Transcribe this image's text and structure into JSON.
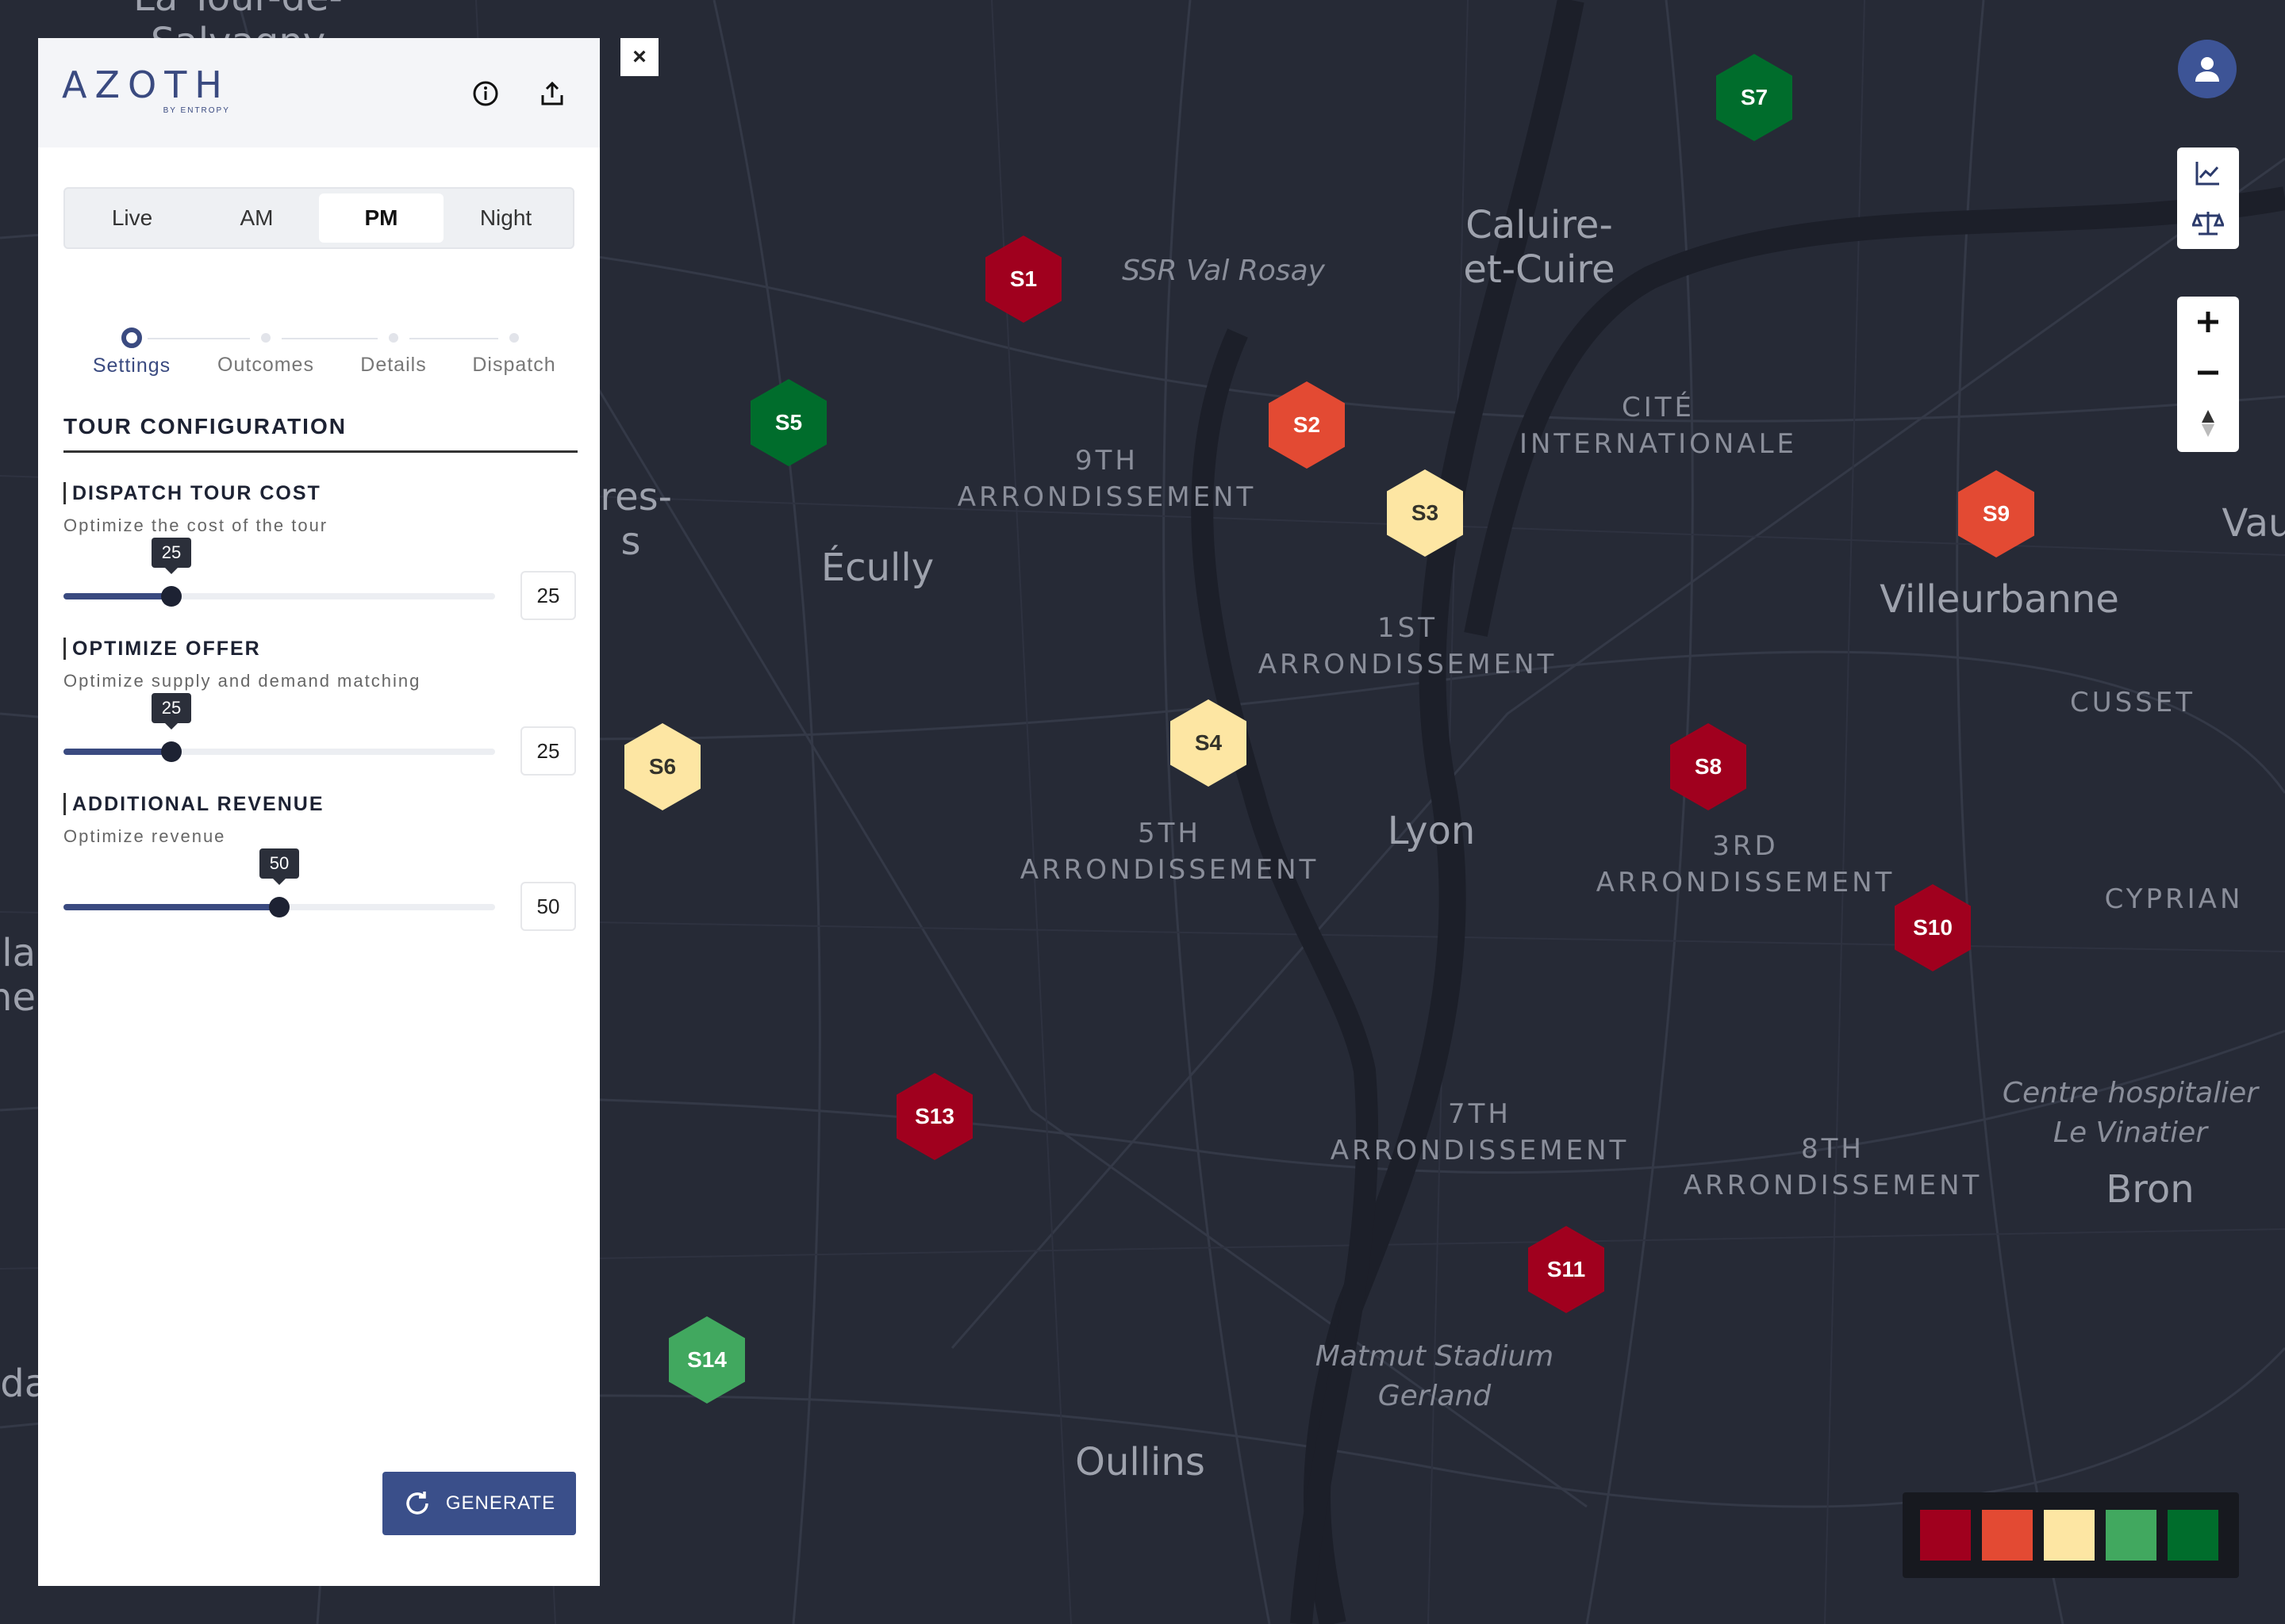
{
  "app": {
    "logo": "AZOTH",
    "logo_sub": "BY ENTROPY"
  },
  "tabs": [
    "Live",
    "AM",
    "PM",
    "Night"
  ],
  "active_tab": "PM",
  "stepper": {
    "steps": [
      "Settings",
      "Outcomes",
      "Details",
      "Dispatch"
    ],
    "active_step": "Settings"
  },
  "config": {
    "title": "TOUR CONFIGURATION",
    "params": [
      {
        "title": "DISPATCH TOUR COST",
        "description": "Optimize the cost of the tour",
        "value": 25,
        "value_label": "25",
        "max": 100
      },
      {
        "title": "OPTIMIZE OFFER",
        "description": "Optimize supply and demand matching",
        "value": 25,
        "value_label": "25",
        "max": 100
      },
      {
        "title": "ADDITIONAL REVENUE",
        "description": "Optimize revenue",
        "value": 50,
        "value_label": "50",
        "max": 100
      }
    ]
  },
  "generate_label": "GENERATE",
  "close_label": "×",
  "map": {
    "place_labels": [
      {
        "text": "Caluire-\net-Cuire",
        "kind": "city"
      },
      {
        "text": "Villeurbanne",
        "kind": "city"
      },
      {
        "text": "Lyon",
        "kind": "city"
      },
      {
        "text": "Écully",
        "kind": "city"
      },
      {
        "text": "Oullins",
        "kind": "city"
      },
      {
        "text": "Bron",
        "kind": "city"
      },
      {
        "text": "Vau",
        "kind": "city"
      },
      {
        "text": "ires-\ns",
        "kind": "city"
      },
      {
        "text": "-la\nne",
        "kind": "city"
      },
      {
        "text": "nda",
        "kind": "city"
      },
      {
        "text": "La Tour-de-\nSalvagny",
        "kind": "city"
      },
      {
        "text": "9TH\nARRONDISSEMENT",
        "kind": "district"
      },
      {
        "text": "CITÉ\nINTERNATIONALE",
        "kind": "district"
      },
      {
        "text": "1ST\nARRONDISSEMENT",
        "kind": "district"
      },
      {
        "text": "5TH\nARRONDISSEMENT",
        "kind": "district"
      },
      {
        "text": "3RD\nARRONDISSEMENT",
        "kind": "district"
      },
      {
        "text": "7TH\nARRONDISSEMENT",
        "kind": "district"
      },
      {
        "text": "8TH\nARRONDISSEMENT",
        "kind": "district"
      },
      {
        "text": "CUSSET",
        "kind": "district"
      },
      {
        "text": "CYPRIAN",
        "kind": "district"
      },
      {
        "text": "SSR Val Rosay",
        "kind": "poi"
      },
      {
        "text": "Centre hospitalier\nLe Vinatier",
        "kind": "poi"
      },
      {
        "text": "Matmut Stadium\nGerland",
        "kind": "poi"
      }
    ],
    "stations": [
      {
        "label": "S1",
        "level": "critical"
      },
      {
        "label": "S2",
        "level": "high"
      },
      {
        "label": "S3",
        "level": "medium"
      },
      {
        "label": "S4",
        "level": "medium"
      },
      {
        "label": "S5",
        "level": "very-good"
      },
      {
        "label": "S6",
        "level": "medium"
      },
      {
        "label": "S7",
        "level": "very-good"
      },
      {
        "label": "S8",
        "level": "critical"
      },
      {
        "label": "S9",
        "level": "high"
      },
      {
        "label": "S10",
        "level": "critical"
      },
      {
        "label": "S11",
        "level": "critical"
      },
      {
        "label": "S13",
        "level": "critical"
      },
      {
        "label": "S14",
        "level": "good"
      }
    ]
  },
  "legend": [
    {
      "level": "critical",
      "color": "#a0001e"
    },
    {
      "level": "high",
      "color": "#e34a33"
    },
    {
      "level": "medium",
      "color": "#fde6a3"
    },
    {
      "level": "good",
      "color": "#41a85f"
    },
    {
      "level": "very-good",
      "color": "#006d2c"
    }
  ],
  "icons": {
    "info": "info-icon",
    "export": "export-icon",
    "user": "user-icon",
    "chart": "chart-icon",
    "balance": "balance-icon",
    "zoom_in": "plus-icon",
    "zoom_out": "minus-icon",
    "compass": "compass-icon",
    "refresh": "refresh-icon"
  }
}
